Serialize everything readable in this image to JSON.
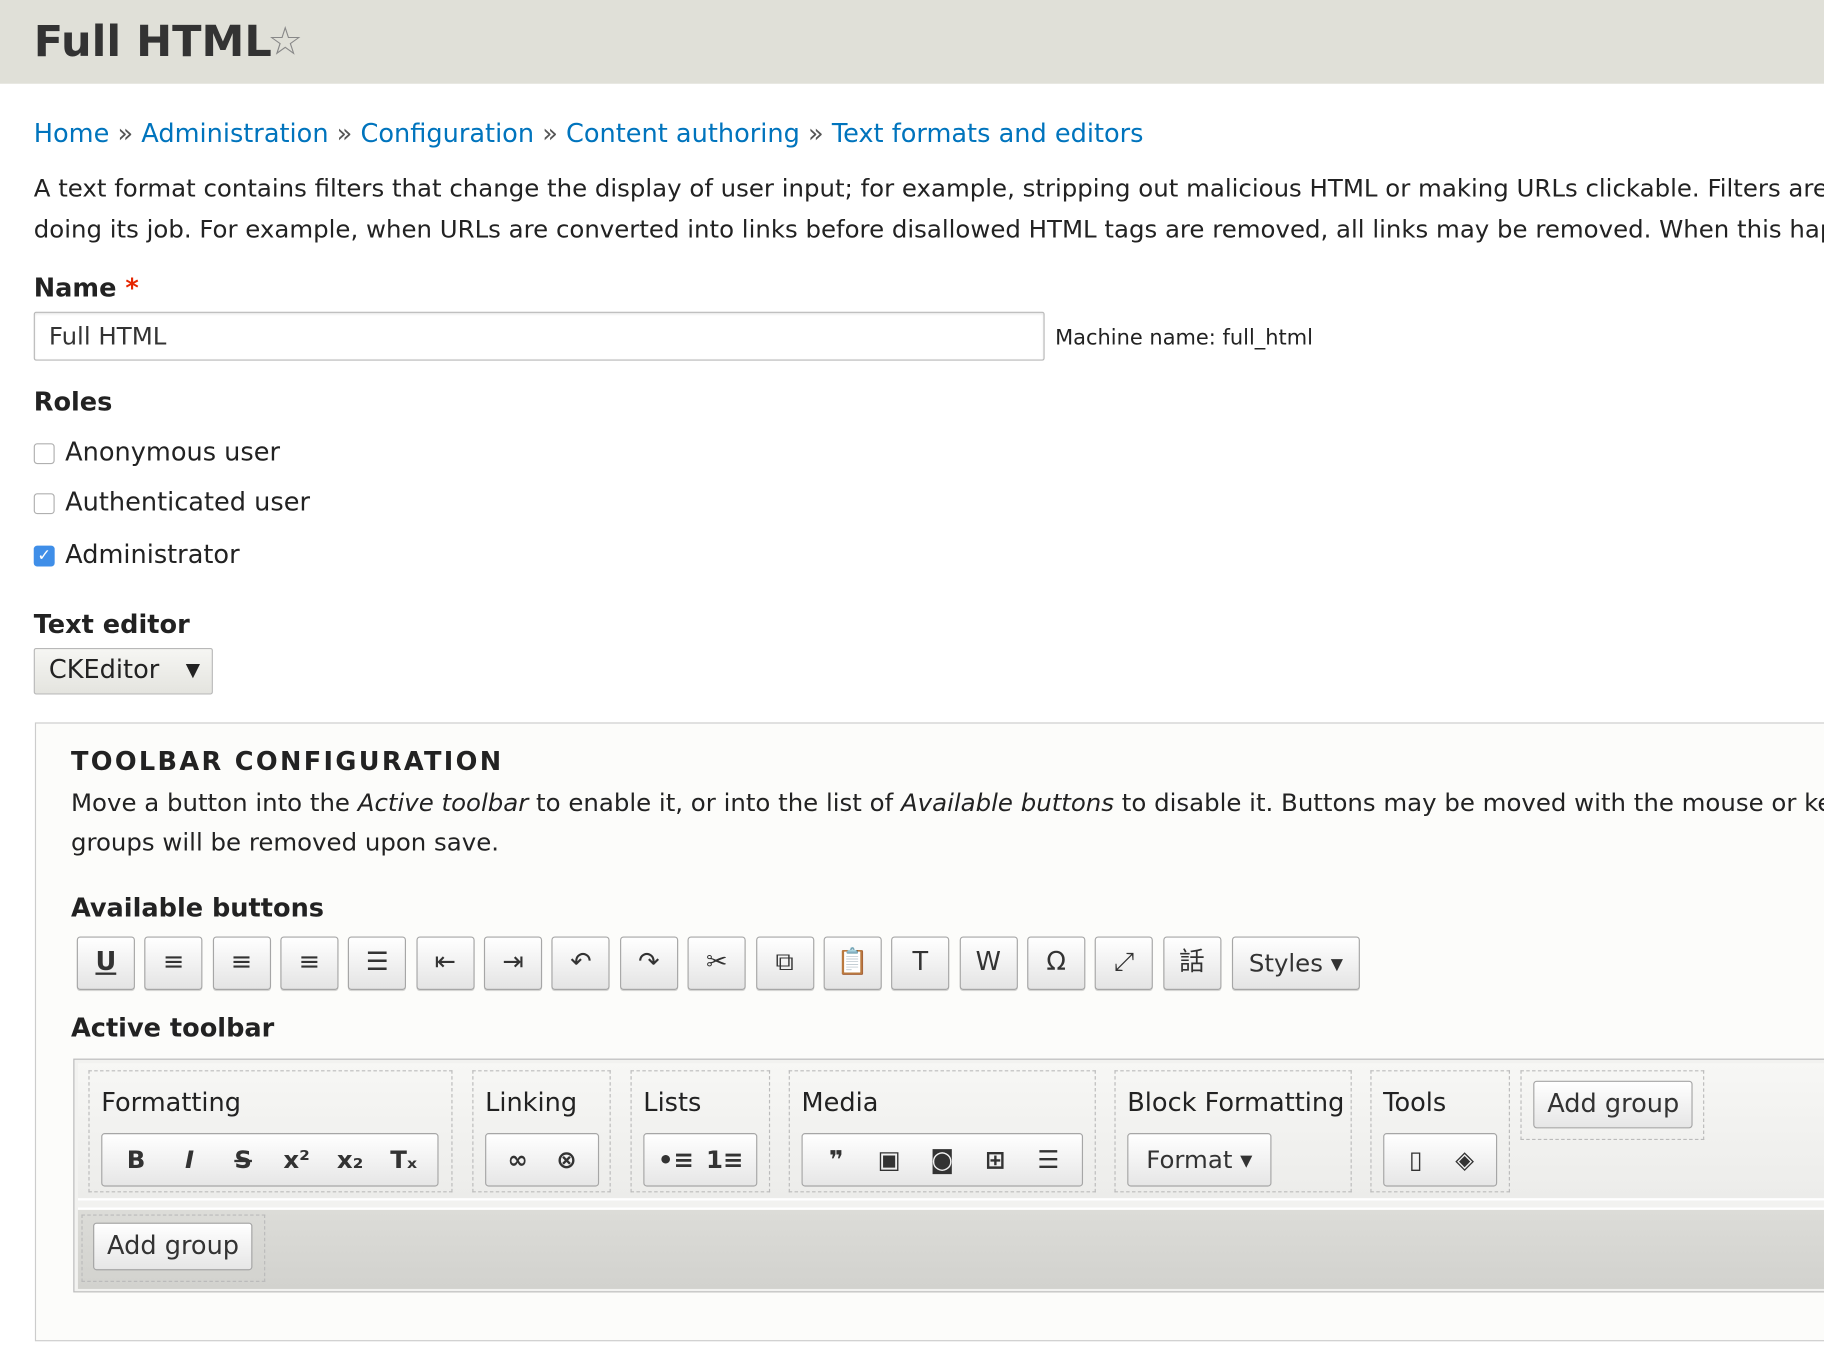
{
  "header": {
    "title": "Full HTML",
    "star_icon": "star-outline-icon"
  },
  "breadcrumb": [
    "Home",
    "Administration",
    "Configuration",
    "Content authoring",
    "Text formats and editors"
  ],
  "breadcrumb_sep": "»",
  "description": [
    "A text format contains filters that change the display of user input; for example, stripping out malicious HTML or making URLs clickable. Filters are executed from top to bottom and the order is important, since one filter may prevent another filter from",
    "doing its job. For example, when URLs are converted into links before disallowed HTML tags are removed, all links may be removed. When this happens, the order of filters may need to be re-arranged."
  ],
  "name": {
    "label": "Name",
    "required_mark": "*",
    "value": "Full HTML",
    "machine_name": "Machine name: full_html"
  },
  "roles": {
    "label": "Roles",
    "items": [
      {
        "label": "Anonymous user",
        "checked": false
      },
      {
        "label": "Authenticated user",
        "checked": false
      },
      {
        "label": "Administrator",
        "checked": true
      }
    ]
  },
  "text_editor": {
    "label": "Text editor",
    "value": "CKEditor"
  },
  "toolbar_config": {
    "legend": "TOOLBAR CONFIGURATION",
    "desc1_a": "Move a button into the ",
    "desc1_b": "Active toolbar",
    "desc1_c": " to enable it, or into the list of ",
    "desc1_d": "Available buttons",
    "desc1_e": " to disable it. Buttons may be moved with the mouse or keyboard arrow keys. Toolbar group names are provided to support screen reader users. Empty toolbar",
    "desc2": "groups will be removed upon save.",
    "available_label": "Available buttons",
    "available_buttons": [
      {
        "icon": "underline-icon",
        "glyph": "U"
      },
      {
        "icon": "align-left-icon",
        "glyph": "≡"
      },
      {
        "icon": "align-center-icon",
        "glyph": "≡"
      },
      {
        "icon": "align-right-icon",
        "glyph": "≡"
      },
      {
        "icon": "justify-icon",
        "glyph": "☰"
      },
      {
        "icon": "outdent-icon",
        "glyph": "⇤"
      },
      {
        "icon": "indent-icon",
        "glyph": "⇥"
      },
      {
        "icon": "undo-icon",
        "glyph": "↶"
      },
      {
        "icon": "redo-icon",
        "glyph": "↷"
      },
      {
        "icon": "cut-icon",
        "glyph": "✂"
      },
      {
        "icon": "copy-icon",
        "glyph": "⧉"
      },
      {
        "icon": "paste-icon",
        "glyph": "📋"
      },
      {
        "icon": "paste-text-icon",
        "glyph": "T"
      },
      {
        "icon": "paste-word-icon",
        "glyph": "W"
      },
      {
        "icon": "special-char-icon",
        "glyph": "Ω"
      },
      {
        "icon": "maximize-icon",
        "glyph": "⤢"
      },
      {
        "icon": "language-icon",
        "glyph": "話"
      }
    ],
    "styles_label": "Styles ▾",
    "active_label": "Active toolbar",
    "groups": [
      {
        "label": "Formatting",
        "buttons": [
          {
            "icon": "bold-icon",
            "glyph": "B"
          },
          {
            "icon": "italic-icon",
            "glyph": "I"
          },
          {
            "icon": "strikethrough-icon",
            "glyph": "S"
          },
          {
            "icon": "superscript-icon",
            "glyph": "x²"
          },
          {
            "icon": "subscript-icon",
            "glyph": "x₂"
          },
          {
            "icon": "remove-format-icon",
            "glyph": "Tₓ"
          }
        ]
      },
      {
        "label": "Linking",
        "buttons": [
          {
            "icon": "link-icon",
            "glyph": "∞"
          },
          {
            "icon": "unlink-icon",
            "glyph": "⊗"
          }
        ]
      },
      {
        "label": "Lists",
        "buttons": [
          {
            "icon": "bulleted-list-icon",
            "glyph": "•≡"
          },
          {
            "icon": "numbered-list-icon",
            "glyph": "1≡"
          }
        ]
      },
      {
        "label": "Media",
        "buttons": [
          {
            "icon": "blockquote-icon",
            "glyph": "❞"
          },
          {
            "icon": "image-icon",
            "glyph": "▣"
          },
          {
            "icon": "flash-icon",
            "glyph": "◙"
          },
          {
            "icon": "table-icon",
            "glyph": "⊞"
          },
          {
            "icon": "horizontal-rule-icon",
            "glyph": "☰"
          }
        ]
      },
      {
        "label": "Block Formatting",
        "format_label": "Format ▾"
      },
      {
        "label": "Tools",
        "buttons": [
          {
            "icon": "show-blocks-icon",
            "glyph": "▯"
          },
          {
            "icon": "source-icon",
            "glyph": "◈"
          }
        ]
      }
    ],
    "add_group_label": "Add group"
  }
}
